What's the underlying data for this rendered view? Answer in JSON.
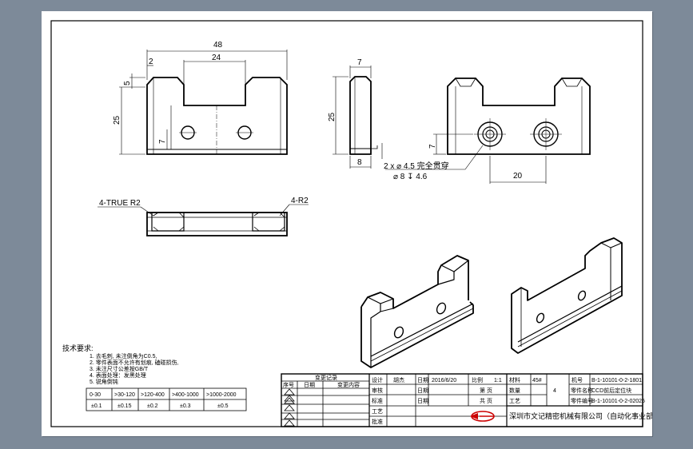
{
  "dims": {
    "front_overall_width": "48",
    "front_inner_width": "24",
    "front_left_offset": "2",
    "front_chamfer": "5",
    "front_height": "25",
    "front_hole_height": "7",
    "side_thickness": "7",
    "side_height": "25",
    "side_bottom": "8",
    "iso_hole_height": "7",
    "iso_hole_pitch": "20",
    "hole_callout_main": "2 x ⌀ 4.5 完全贯穿",
    "hole_callout_cbore": "⌀ 8 ↧ 4.6",
    "top_view_label_left": "4-TRUE R2",
    "top_view_label_right": "4-R2"
  },
  "notes": {
    "title": "技术要求:",
    "lines": [
      "1. 去毛刺, 未注倒角为C0.5,",
      "2. 零件表面不允许有划痕, 磕碰损伤,",
      "3. 未注尺寸公差按GB/T",
      "4. 表面处理：发黑处理",
      "5. 锐角倒钝"
    ],
    "tolerance_headers": [
      "0-30",
      ">30-120",
      ">120-400",
      ">400-1000",
      ">1000-2000"
    ],
    "tolerance_values": [
      "±0.1",
      "±0.15",
      "±0.2",
      "±0.3",
      "±0.5"
    ]
  },
  "title_block": {
    "revision_header": "变更记录",
    "rev_col_1": "序号",
    "rev_col_2": "日期",
    "rev_col_3": "变更内容",
    "design_label": "设计",
    "designer": "胡杰",
    "design_date": "2016/6/20",
    "check_label": "审核",
    "check_date_label": "日期",
    "approve_label": "批准",
    "standard_label": "标准",
    "scale_label": "比例",
    "scale_value": "1:1",
    "material_label": "材料",
    "material_value": "45#",
    "name_label": "机号",
    "name_value": "B-1-10101-0-2-1801",
    "page_label": "第 页",
    "qty_label": "数量",
    "qty_value": "4",
    "part_name_label": "零件名称",
    "part_name_value": "CCD前后定位块",
    "total_label": "共 页",
    "process_label": "工艺",
    "part_no_label": "零件编号",
    "part_no_value": "B-1-10101-0-2-02025",
    "company": "深圳市文记精密机械有限公司（自动化事业部）"
  },
  "colors": {
    "background": "#7d8a99",
    "sheet": "#ffffff",
    "line": "#000000",
    "logo_red": "#cc0000"
  }
}
